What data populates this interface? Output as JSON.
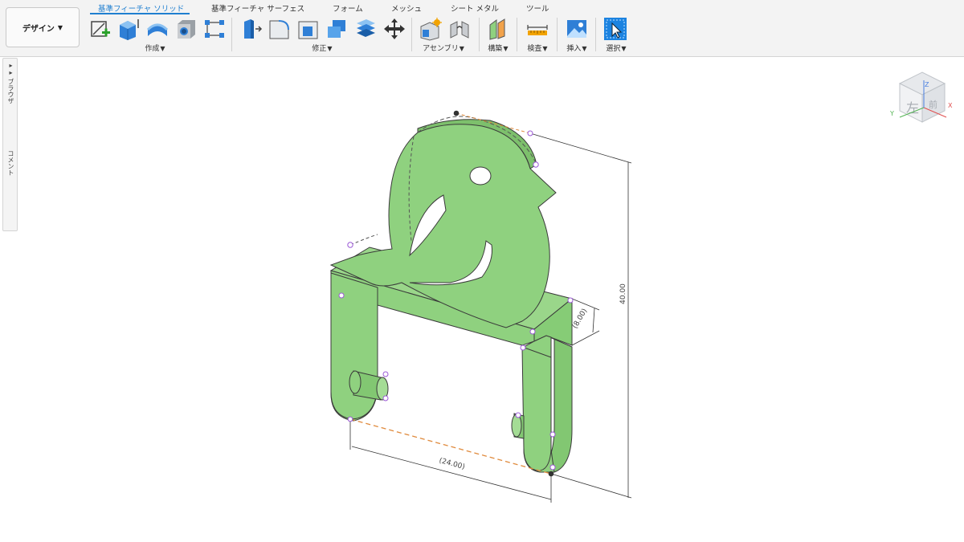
{
  "workspace": {
    "label": "デザイン"
  },
  "tabs": [
    "基準フィーチャ ソリッド",
    "基準フィーチャ サーフェス",
    "フォーム",
    "メッシュ",
    "シート メタル",
    "ツール"
  ],
  "groups": {
    "create": "作成",
    "modify": "修正",
    "assemble": "アセンブリ",
    "construct": "構築",
    "inspect": "検査",
    "insert": "挿入",
    "select": "選択"
  },
  "side_panel": {
    "browser": "ブラウザ",
    "comments": "コメント"
  },
  "viewcube": {
    "face_left": "左",
    "face_front": "前",
    "axis_x": "X",
    "axis_y": "Y",
    "axis_z": "Z"
  },
  "dimensions": {
    "height": "40.00",
    "depth": "(8.00)",
    "width": "(24.00)"
  },
  "colors": {
    "accent": "#1f7fd0",
    "model_fill": "#8fd17f",
    "model_edge": "#3a3a3a",
    "sketch_point": "#9b59d6",
    "dim_line": "#e08a3c"
  },
  "icons": [
    "sketch-icon",
    "extrude-icon",
    "revolve-icon",
    "hole-icon",
    "pattern-icon",
    "press-pull-icon",
    "fillet-icon",
    "chamfer-icon",
    "combine-icon",
    "shell-icon",
    "move-icon",
    "new-component-icon",
    "joint-icon",
    "plane-icon",
    "measure-icon",
    "insert-image-icon",
    "select-icon"
  ]
}
